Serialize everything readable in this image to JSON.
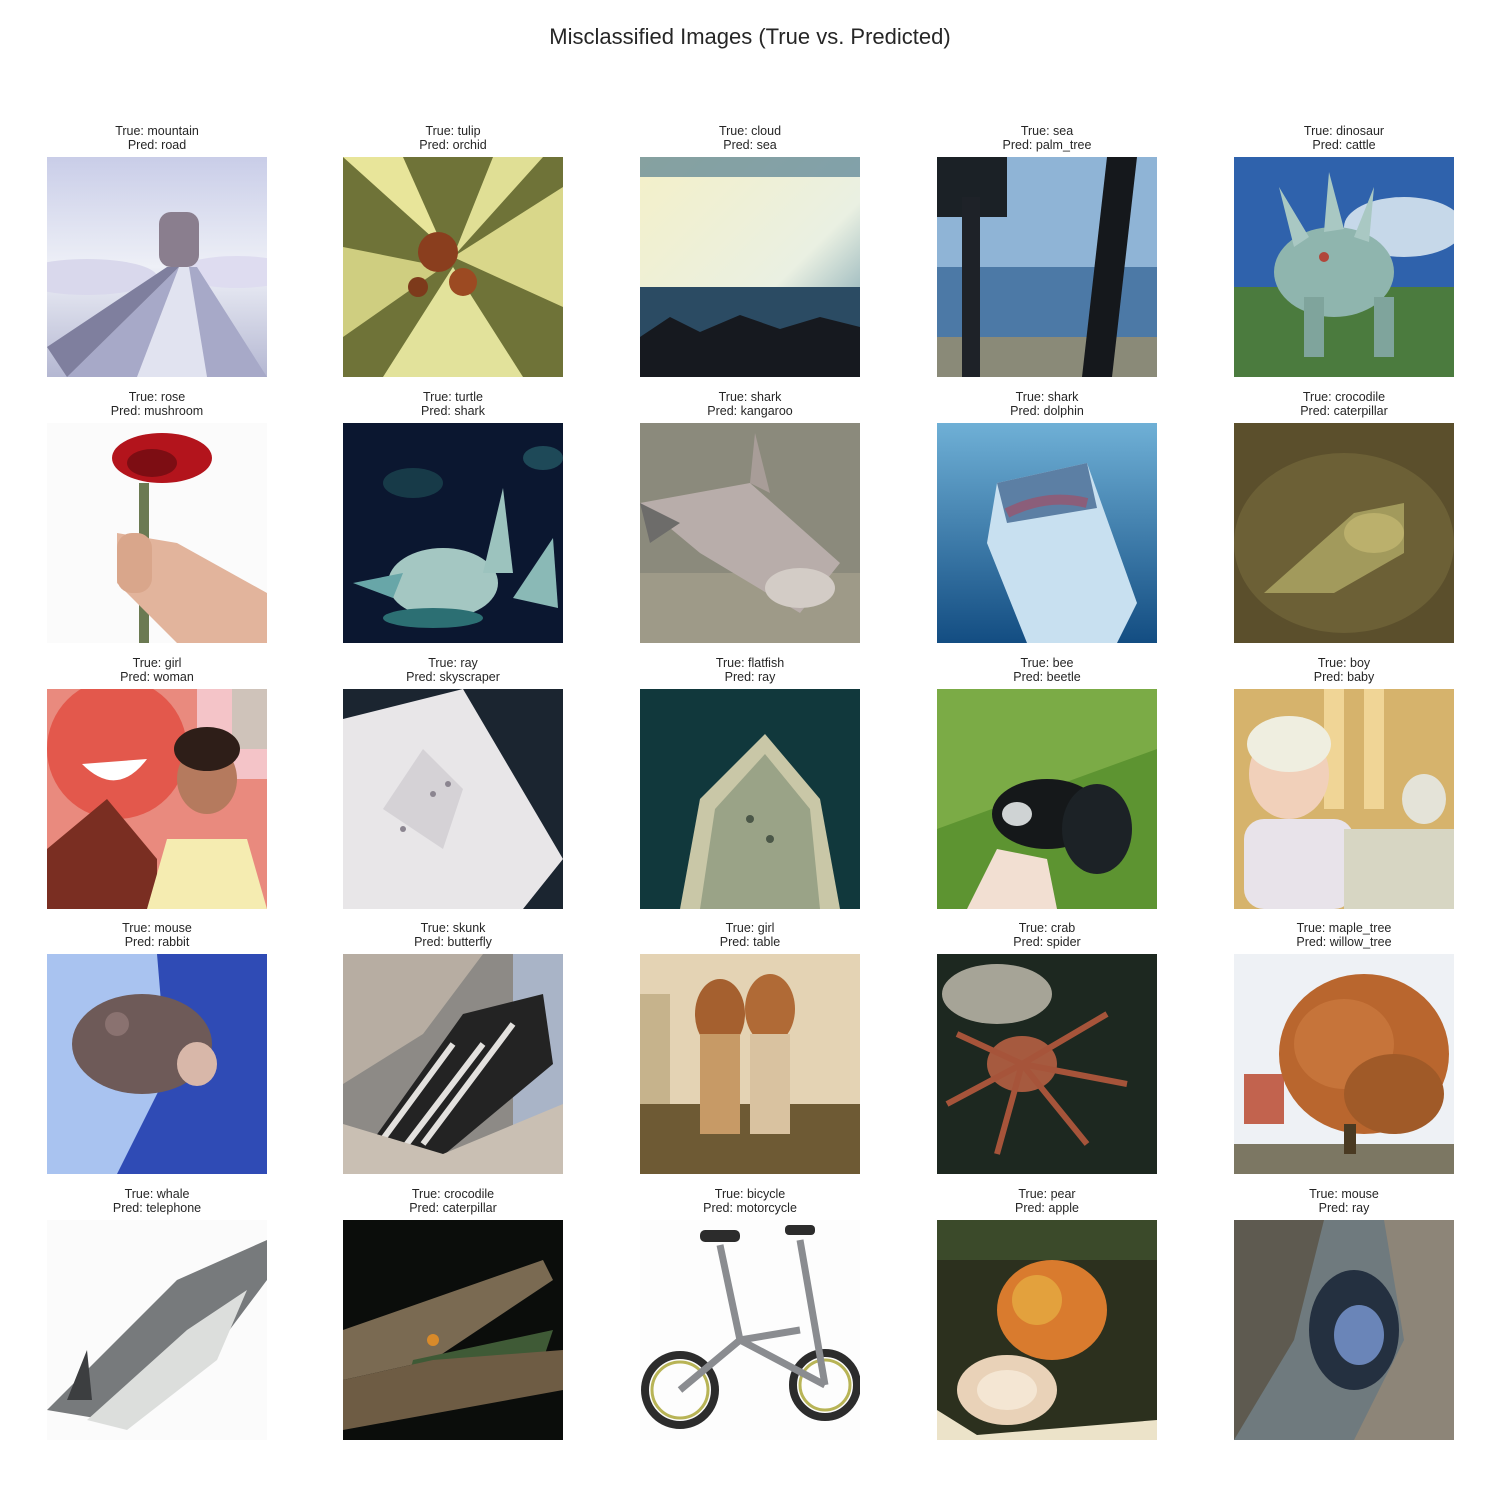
{
  "title": "Misclassified Images (True vs. Predicted)",
  "cells": [
    {
      "true_label": "True: mountain",
      "pred_label": "Pred: road",
      "icon": "mountain-road-photo"
    },
    {
      "true_label": "True: tulip",
      "pred_label": "Pred: orchid",
      "icon": "yellow-lily-flower-photo"
    },
    {
      "true_label": "True: cloud",
      "pred_label": "Pred: sea",
      "icon": "bright-sky-horizon-photo"
    },
    {
      "true_label": "True: sea",
      "pred_label": "Pred: palm_tree",
      "icon": "sea-through-trees-photo"
    },
    {
      "true_label": "True: dinosaur",
      "pred_label": "Pred: cattle",
      "icon": "dinosaur-statue-photo"
    },
    {
      "true_label": "True: rose",
      "pred_label": "Pred: mushroom",
      "icon": "hand-holding-red-rose-photo"
    },
    {
      "true_label": "True: turtle",
      "pred_label": "Pred: shark",
      "icon": "sea-turtle-dark-water-photo"
    },
    {
      "true_label": "True: shark",
      "pred_label": "Pred: kangaroo",
      "icon": "shark-on-sand-photo"
    },
    {
      "true_label": "True: shark",
      "pred_label": "Pred: dolphin",
      "icon": "great-white-shark-photo"
    },
    {
      "true_label": "True: crocodile",
      "pred_label": "Pred: caterpillar",
      "icon": "camouflaged-crocodile-photo"
    },
    {
      "true_label": "True: girl",
      "pred_label": "Pred: woman",
      "icon": "smiling-girls-photo"
    },
    {
      "true_label": "True: ray",
      "pred_label": "Pred: skyscraper",
      "icon": "stingray-underside-photo"
    },
    {
      "true_label": "True: flatfish",
      "pred_label": "Pred: ray",
      "icon": "flatfish-photo"
    },
    {
      "true_label": "True: bee",
      "pred_label": "Pred: beetle",
      "icon": "bee-on-leaf-photo"
    },
    {
      "true_label": "True: boy",
      "pred_label": "Pred: baby",
      "icon": "blond-boy-photo"
    },
    {
      "true_label": "True: mouse",
      "pred_label": "Pred: rabbit",
      "icon": "mouse-on-blue-cloth-photo"
    },
    {
      "true_label": "True: skunk",
      "pred_label": "Pred: butterfly",
      "icon": "skunk-on-rock-photo"
    },
    {
      "true_label": "True: girl",
      "pred_label": "Pred: table",
      "icon": "two-girls-room-photo"
    },
    {
      "true_label": "True: crab",
      "pred_label": "Pred: spider",
      "icon": "crab-dark-background-photo"
    },
    {
      "true_label": "True: maple_tree",
      "pred_label": "Pred: willow_tree",
      "icon": "autumn-maple-tree-photo"
    },
    {
      "true_label": "True: whale",
      "pred_label": "Pred: telephone",
      "icon": "whale-white-background-photo"
    },
    {
      "true_label": "True: crocodile",
      "pred_label": "Pred: caterpillar",
      "icon": "crocodile-open-jaws-photo"
    },
    {
      "true_label": "True: bicycle",
      "pred_label": "Pred: motorcycle",
      "icon": "folding-bicycle-photo"
    },
    {
      "true_label": "True: pear",
      "pred_label": "Pred: apple",
      "icon": "sliced-pear-photo"
    },
    {
      "true_label": "True: mouse",
      "pred_label": "Pred: ray",
      "icon": "mouse-in-rock-photo"
    }
  ]
}
